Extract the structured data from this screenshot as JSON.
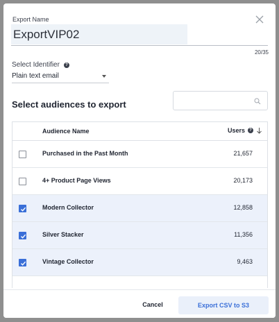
{
  "export_name": {
    "label": "Export Name",
    "value": "ExportVIP02",
    "char_count": "20/35"
  },
  "identifier": {
    "label": "Select Identifier",
    "selected": "Plain text email"
  },
  "section_title": "Select audiences to export",
  "search": {
    "placeholder": ""
  },
  "table": {
    "col_name": "Audience Name",
    "col_users": "Users",
    "rows": [
      {
        "name": "Purchased in the Past Month",
        "users": "21,657",
        "checked": false
      },
      {
        "name": "4+ Product Page Views",
        "users": "20,173",
        "checked": false
      },
      {
        "name": "Modern Collector",
        "users": "12,858",
        "checked": true
      },
      {
        "name": "Silver Stacker",
        "users": "11,356",
        "checked": true
      },
      {
        "name": "Vintage Collector",
        "users": "9,463",
        "checked": true
      }
    ]
  },
  "footer": {
    "cancel_label": "Cancel",
    "export_label": "Export CSV to S3"
  },
  "colors": {
    "accent": "#3a6fd8",
    "selected_row": "#ecf1fb"
  },
  "icons": {
    "close": "close-icon",
    "info": "info-icon",
    "search": "search-icon",
    "sort": "arrow-down-icon",
    "check": "checkmark-icon"
  }
}
